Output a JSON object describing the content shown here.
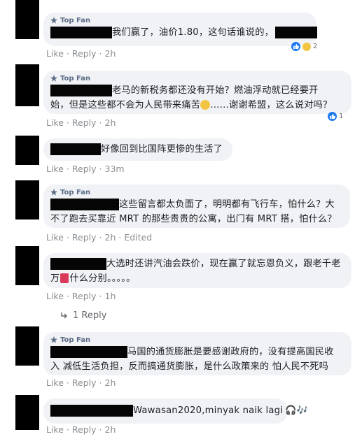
{
  "top_fan_label": "Top Fan",
  "actions": {
    "like": "Like",
    "reply": "Reply",
    "sep": "·",
    "edited": "Edited"
  },
  "comments": [
    {
      "text": "我们赢了，油价1.80，这句话谁说的，",
      "time": "2h",
      "reaction_count": "2"
    },
    {
      "text1": "老马的新税务都还没有开始？燃油浮动就已经要开",
      "text2": "始，但是这些都不会为人民带来痛苦",
      "text2b": "……谢谢希盟，这么说对吗？",
      "time": "2h",
      "reaction_count": "1"
    },
    {
      "text": "好像回到比国阵更惨的生活了",
      "time": "33m"
    },
    {
      "text1": "这些留言都太负面了，明明都有飞行车，怕什么？大",
      "text2": "不了跑去买靠近 MRT 的那些贵贵的公寓，出门有 MRT 搭，怕什么？",
      "time": "2h"
    },
    {
      "text1": "大选时还讲汽油会跌价，现在赢了就忘恩负义，跟老千老",
      "text2a": "万",
      "text2b": "什么分别。。。。。",
      "time": "1h",
      "replies": "1 Reply"
    },
    {
      "text1": "马国的通货膨胀是要感谢政府的，没有提高国民收",
      "text2": "入 减低生活负担，反而搞通货膨胀，是什么政策来的 怕人民不死吗",
      "time": "2h"
    },
    {
      "text": "Wawasan2020,minyak naik lagi",
      "time": "2h"
    }
  ]
}
